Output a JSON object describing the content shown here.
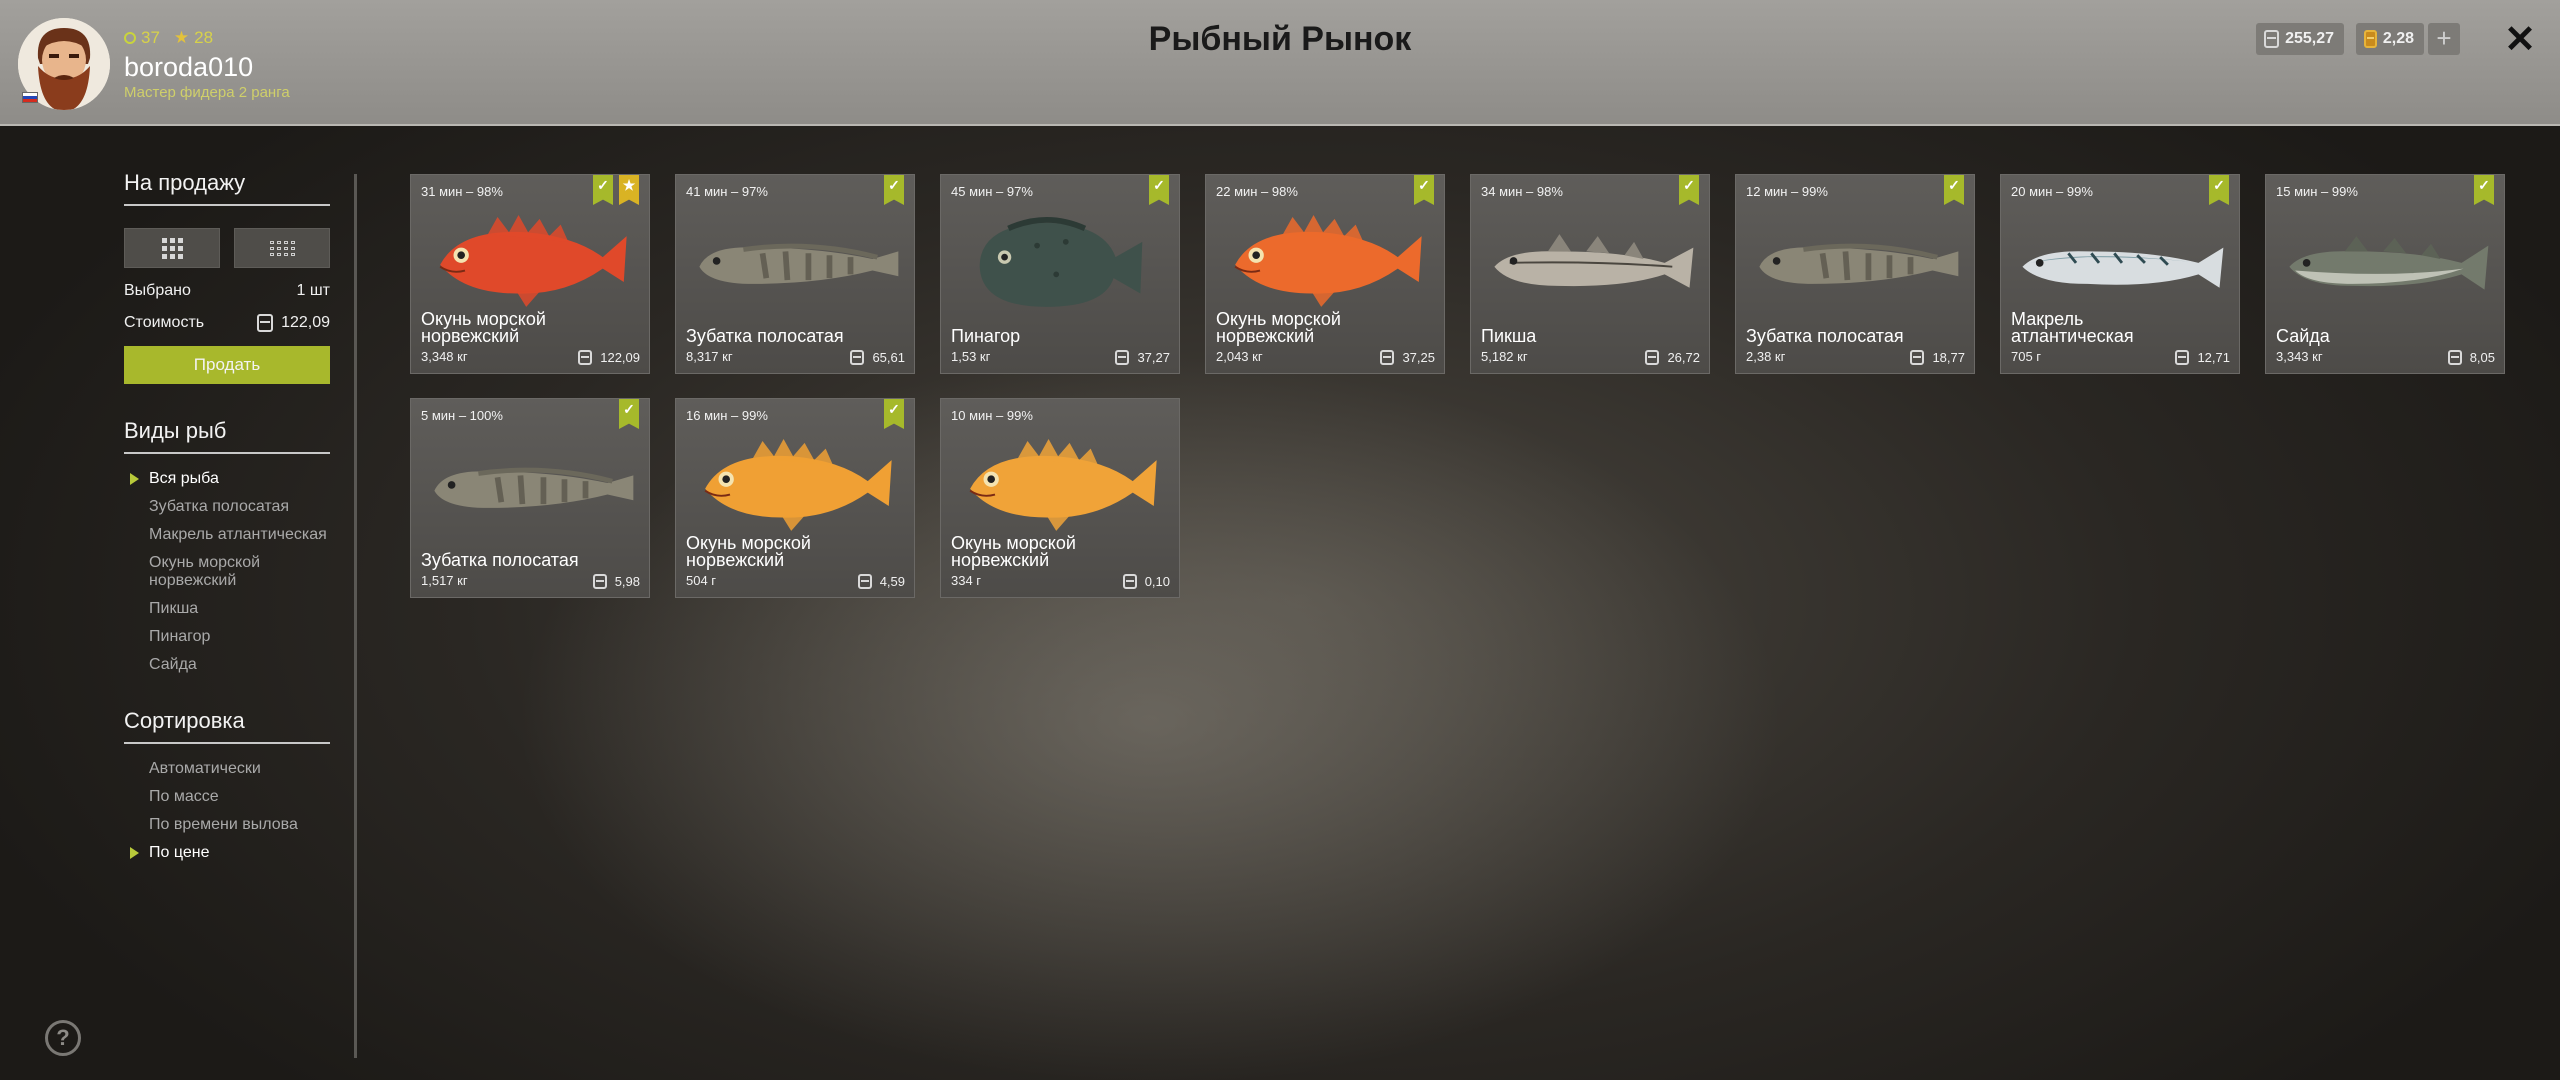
{
  "header": {
    "title": "Рыбный Рынок",
    "level": "37",
    "stars": "28",
    "username": "boroda010",
    "rank": "Мастер фидера 2 ранга",
    "silver": "255,27",
    "gold": "2,28",
    "plus": "+",
    "close": "✕"
  },
  "sidebar": {
    "sale_title": "На продажу",
    "selected_label": "Выбрано",
    "selected_value": "1 шт",
    "cost_label": "Стоимость",
    "cost_value": "122,09",
    "sell_label": "Продать",
    "species_title": "Виды рыб",
    "species": [
      "Вся рыба",
      "Зубатка полосатая",
      "Макрель атлантическая",
      "Окунь морской норвежский",
      "Пикша",
      "Пинагор",
      "Сайда"
    ],
    "species_active": 0,
    "sort_title": "Сортировка",
    "sort": [
      "Автоматически",
      "По массе",
      "По времени вылова",
      "По цене"
    ],
    "sort_active": 3,
    "help": "?"
  },
  "cards": [
    {
      "time": "31 мин – 98%",
      "name": "Окунь морской норвежский",
      "weight": "3,348 кг",
      "price": "122,09",
      "checked": true,
      "starred": true,
      "fish": "redfish",
      "color": "#e0492a"
    },
    {
      "time": "41 мин – 97%",
      "name": "Зубатка полосатая",
      "weight": "8,317 кг",
      "price": "65,61",
      "checked": true,
      "starred": false,
      "fish": "wolffish",
      "color": "#8a8676"
    },
    {
      "time": "45 мин – 97%",
      "name": "Пинагор",
      "weight": "1,53 кг",
      "price": "37,27",
      "checked": true,
      "starred": false,
      "fish": "lumpfish",
      "color": "#3f514b"
    },
    {
      "time": "22 мин – 98%",
      "name": "Окунь морской норвежский",
      "weight": "2,043 кг",
      "price": "37,25",
      "checked": true,
      "starred": false,
      "fish": "redfish",
      "color": "#ec6a2c"
    },
    {
      "time": "34 мин – 98%",
      "name": "Пикша",
      "weight": "5,182 кг",
      "price": "26,72",
      "checked": true,
      "starred": false,
      "fish": "haddock",
      "color": "#b9b2a6"
    },
    {
      "time": "12 мин – 99%",
      "name": "Зубатка полосатая",
      "weight": "2,38 кг",
      "price": "18,77",
      "checked": true,
      "starred": false,
      "fish": "wolffish",
      "color": "#8a8676"
    },
    {
      "time": "20 мин – 99%",
      "name": "Макрель атлантическая",
      "weight": "705 г",
      "price": "12,71",
      "checked": true,
      "starred": false,
      "fish": "mackerel",
      "color": "#7f9ea6"
    },
    {
      "time": "15 мин – 99%",
      "name": "Сайда",
      "weight": "3,343 кг",
      "price": "8,05",
      "checked": true,
      "starred": false,
      "fish": "saithe",
      "color": "#737a6c"
    },
    {
      "time": "5 мин – 100%",
      "name": "Зубатка полосатая",
      "weight": "1,517 кг",
      "price": "5,98",
      "checked": true,
      "starred": false,
      "fish": "wolffish",
      "color": "#8a8676"
    },
    {
      "time": "16 мин – 99%",
      "name": "Окунь морской норвежский",
      "weight": "504 г",
      "price": "4,59",
      "checked": true,
      "starred": false,
      "fish": "redfish",
      "color": "#f0a034"
    },
    {
      "time": "10 мин – 99%",
      "name": "Окунь морской норвежский",
      "weight": "334 г",
      "price": "0,10",
      "checked": false,
      "starred": false,
      "fish": "redfish",
      "color": "#f0a338"
    }
  ]
}
